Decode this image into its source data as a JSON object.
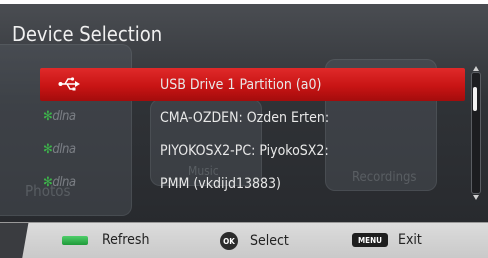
{
  "dialog": {
    "title": "Device Selection"
  },
  "devices": [
    {
      "label": "USB Drive 1 Partition (a0)",
      "icon": "usb-icon",
      "selected": true
    },
    {
      "label": "CMA-OZDEN: Ozden Erten:",
      "icon": "dlna-icon",
      "selected": false
    },
    {
      "label": "PIYOKOSX2-PC: PiyokoSX2:",
      "icon": "dlna-icon",
      "selected": false
    },
    {
      "label": "PMM  (vkdijd13883)",
      "icon": "dlna-icon",
      "selected": false
    }
  ],
  "dlna_logo_text": "dlna",
  "background_labels": {
    "photos": "Photos",
    "music": "Music",
    "recordings": "Recordings"
  },
  "footer": {
    "refresh_label": "Refresh",
    "ok_key": "OK",
    "select_label": "Select",
    "menu_key": "MENU",
    "exit_label": "Exit"
  },
  "colors": {
    "selection_red": "#c81414",
    "refresh_key_green": "#2fb34c",
    "footer_bg": "#d4d4d4",
    "dialog_bg": "#2f3236"
  }
}
